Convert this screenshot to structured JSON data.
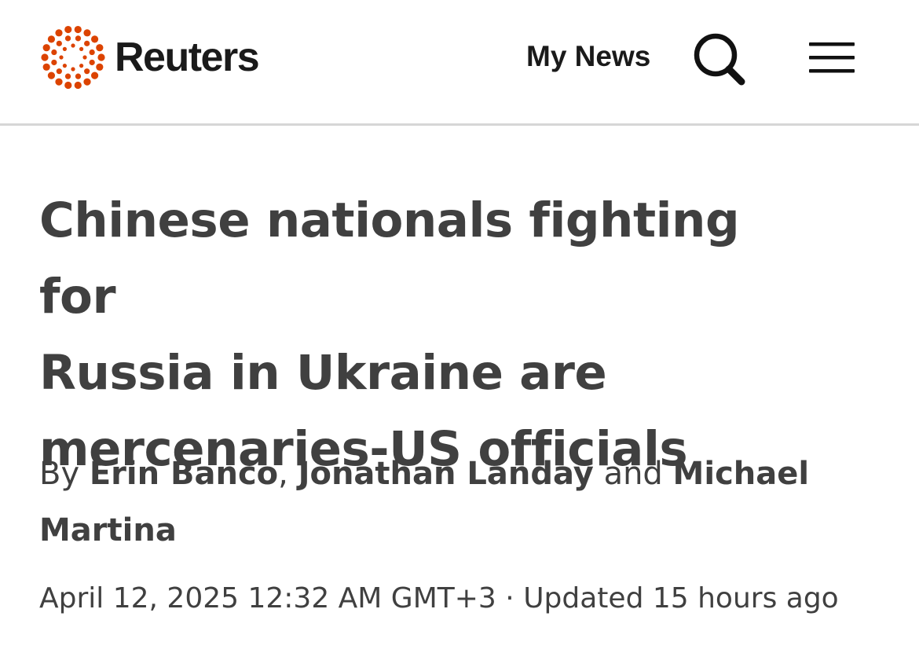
{
  "header": {
    "logo_text": "Reuters",
    "my_news_label": "My News",
    "search_icon": "search-icon",
    "menu_icon": "hamburger-menu-icon",
    "brand_color": "#dc4300"
  },
  "article": {
    "headline_line1": "Chinese nationals fighting for",
    "headline_line2": "Russia in Ukraine are",
    "headline_line3": "mercenaries-US officials",
    "byline_prefix": "By",
    "authors": [
      "Erin Banco",
      "Jonathan Landay",
      "Michael Martina"
    ],
    "byline_separator_1": ",",
    "byline_separator_2": "and",
    "published": "April 12, 2025 12:32 AM GMT+3",
    "dot_separator": "·",
    "updated": "Updated 15 hours ago"
  }
}
